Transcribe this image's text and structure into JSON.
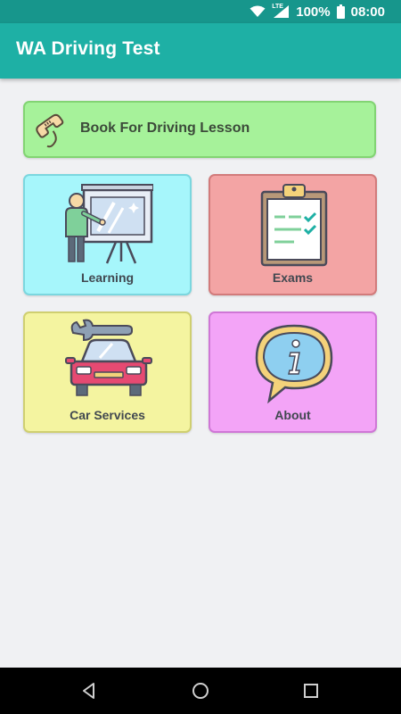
{
  "status_bar": {
    "network": "LTE",
    "battery": "100%",
    "time": "08:00"
  },
  "app_bar": {
    "title": "WA Driving Test"
  },
  "main": {
    "book_button": {
      "label": "Book For Driving Lesson",
      "icon": "phone-handset-icon",
      "color": "#a6f29a"
    },
    "tiles": [
      {
        "label": "Learning",
        "icon": "teacher-whiteboard-icon",
        "color": "#a6f6fb"
      },
      {
        "label": "Exams",
        "icon": "clipboard-checklist-icon",
        "color": "#f3a4a4"
      },
      {
        "label": "Car Services",
        "icon": "car-wrench-icon",
        "color": "#f4f4a0"
      },
      {
        "label": "About",
        "icon": "info-speech-bubble-icon",
        "color": "#f3a4f7"
      }
    ]
  },
  "colors": {
    "status_bar": "#17968c",
    "app_bar": "#1eb0a5",
    "background": "#f0f1f3"
  },
  "nav_bar": {
    "buttons": [
      "back-icon",
      "home-icon",
      "recents-icon"
    ]
  }
}
